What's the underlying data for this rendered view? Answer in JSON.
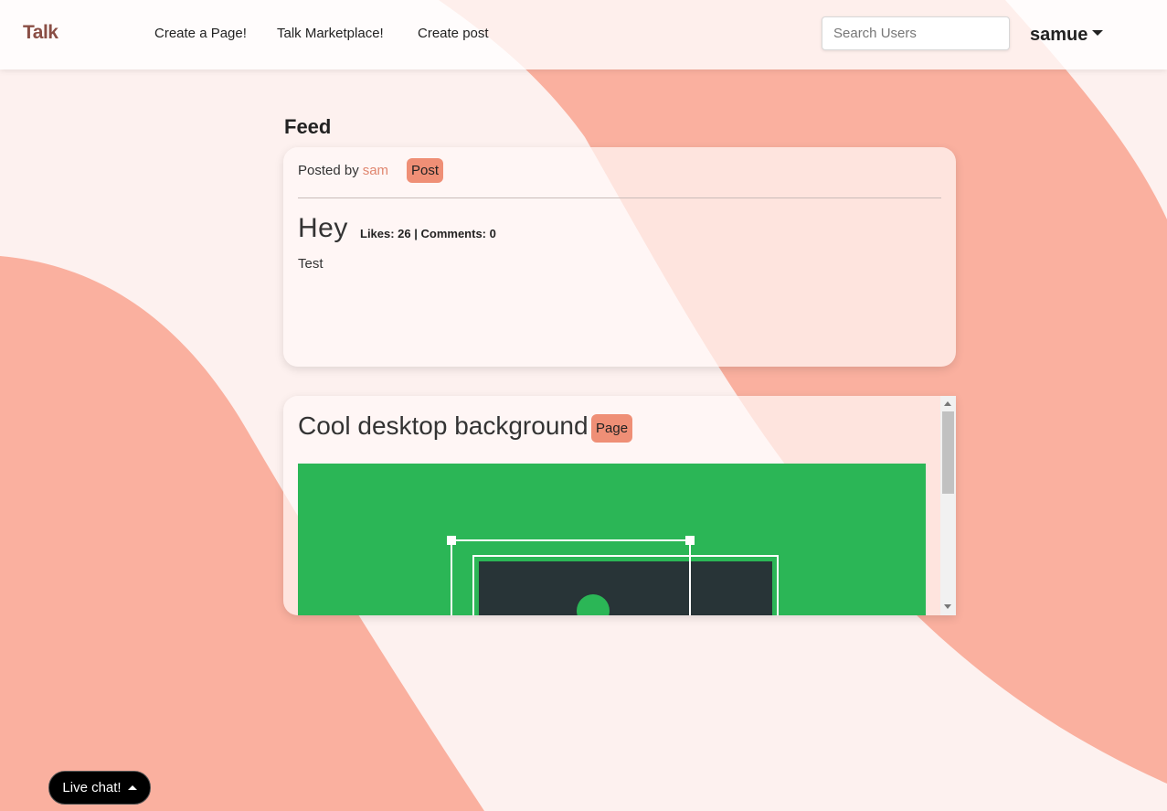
{
  "navbar": {
    "brand": "Talk",
    "links": [
      "Create a Page!",
      "Talk Marketplace!",
      "Create post"
    ],
    "search_placeholder": "Search Users",
    "username": "samue"
  },
  "feed": {
    "title": "Feed",
    "post": {
      "posted_by_label": "Posted by",
      "author": "sam",
      "badge": "Post",
      "title": "Hey",
      "stats": "Likes: 26 | Comments: 0",
      "body": "Test"
    },
    "page": {
      "title": "Cool desktop background",
      "badge": "Page"
    }
  },
  "live_chat": {
    "label": "Live chat!"
  },
  "colors": {
    "accent": "#ef8f76",
    "brand": "#8a4e45",
    "blob": "#fab09f",
    "image_green": "#2bb656",
    "image_dark": "#283437"
  }
}
